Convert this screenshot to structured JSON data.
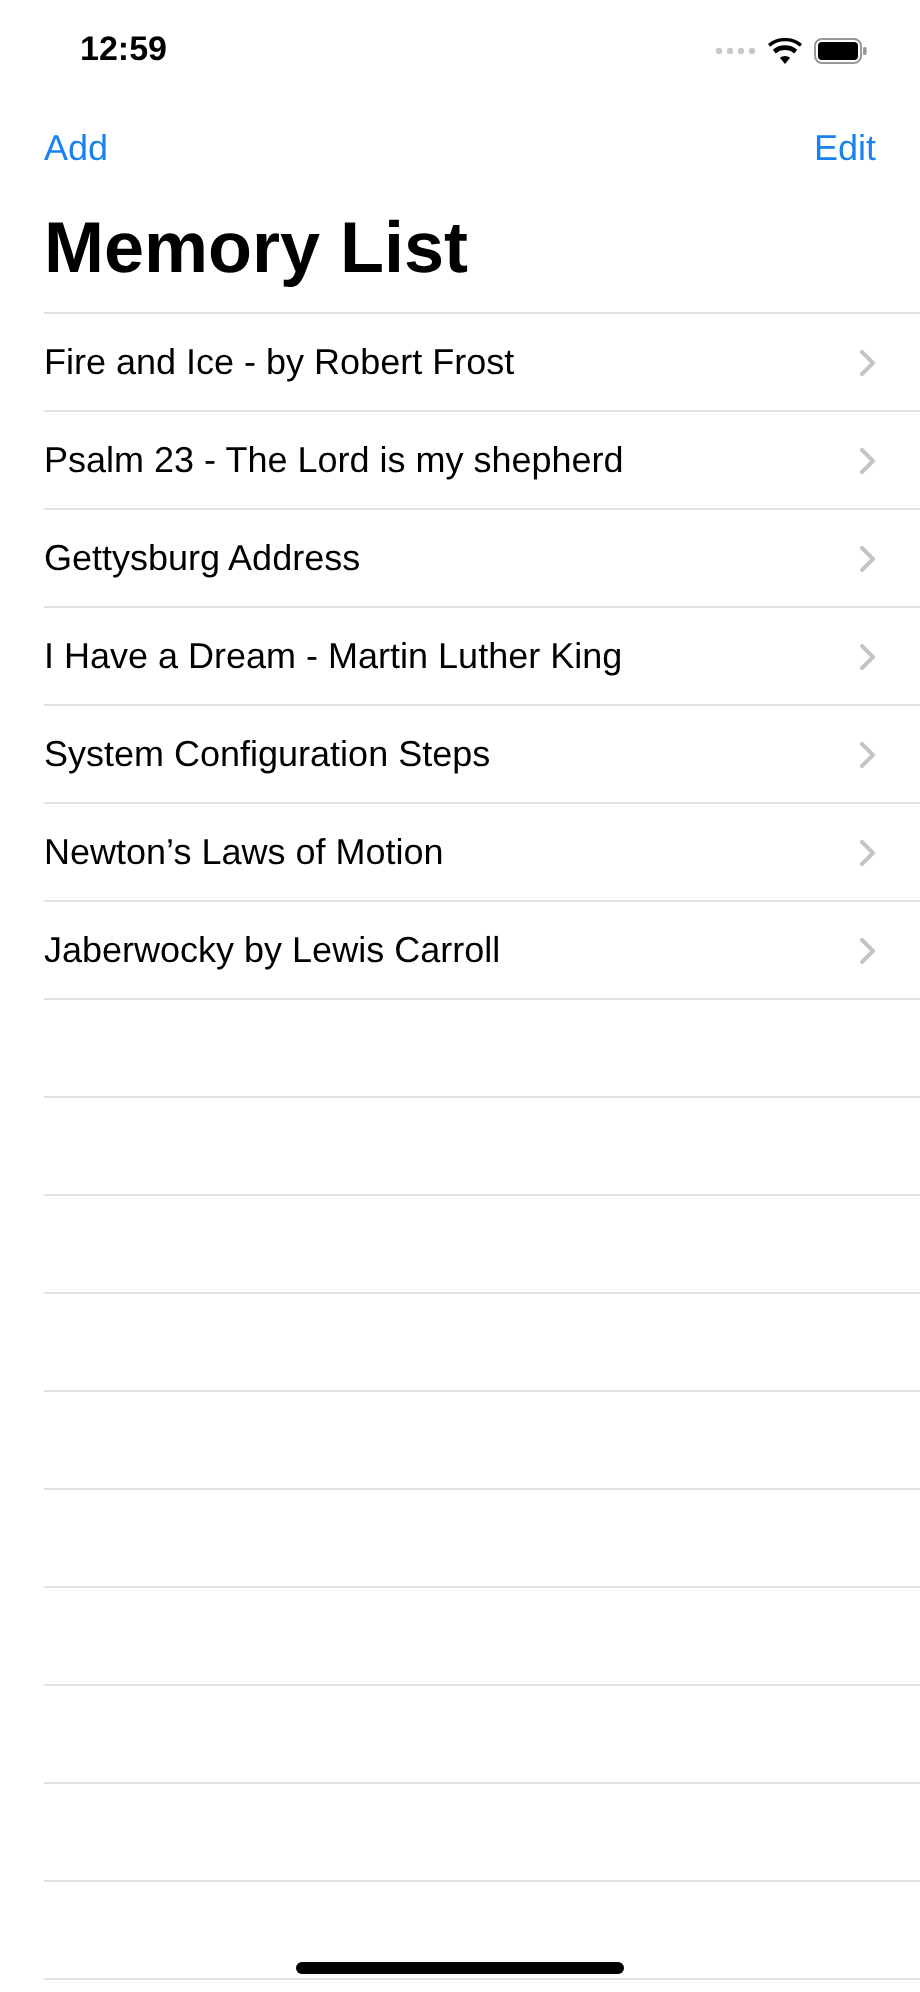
{
  "status_bar": {
    "time": "12:59"
  },
  "nav": {
    "left_button": "Add",
    "right_button": "Edit",
    "title": "Memory List"
  },
  "list": {
    "items": [
      {
        "title": "Fire and Ice - by Robert Frost"
      },
      {
        "title": "Psalm 23 - The Lord is my shepherd"
      },
      {
        "title": "Gettysburg Address"
      },
      {
        "title": "I Have a Dream - Martin Luther King"
      },
      {
        "title": "System Configuration Steps"
      },
      {
        "title": "Newton’s Laws of Motion"
      },
      {
        "title": "Jaberwocky by Lewis Carroll"
      }
    ]
  }
}
